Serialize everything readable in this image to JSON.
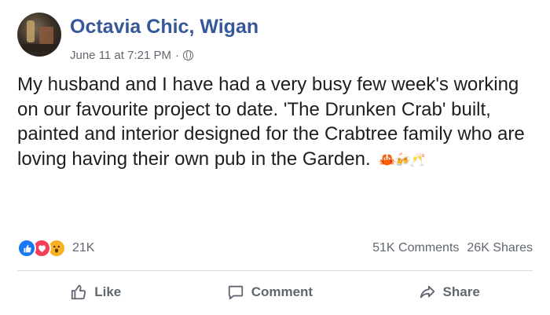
{
  "post": {
    "page_name": "Octavia Chic, Wigan",
    "timestamp": "June 11 at 7:21 PM",
    "separator": "·",
    "privacy_icon": "globe-icon",
    "body": "My husband and I have had a very busy few week's working on our favourite project to date. 'The Drunken Crab' built, painted and interior designed for the Crabtree family who are loving having their own pub in the Garden.",
    "emojis": "🦀🍻🥂"
  },
  "stats": {
    "reaction_icons": [
      "like-icon",
      "love-icon",
      "wow-icon"
    ],
    "reaction_count": "21K",
    "comments": "51K Comments",
    "shares": "26K Shares"
  },
  "actions": {
    "like": "Like",
    "comment": "Comment",
    "share": "Share"
  },
  "colors": {
    "page_name": "#365899",
    "meta_text": "#616770",
    "divider": "#dadde1",
    "like": "#1877f2",
    "love": "#f33e58",
    "wow": "#f7b125"
  }
}
